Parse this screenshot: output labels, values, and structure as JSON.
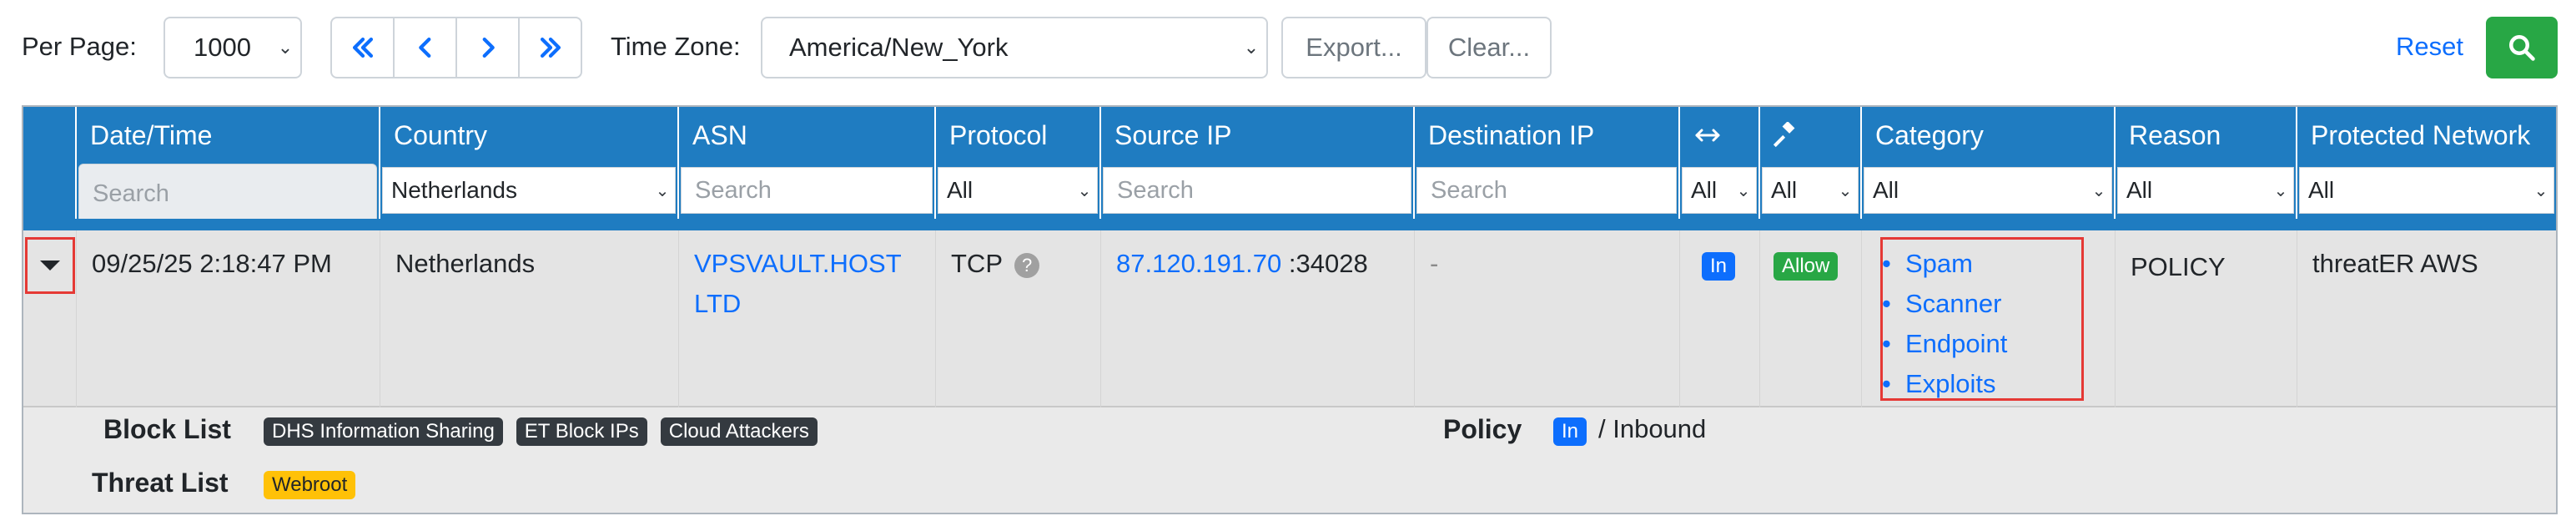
{
  "toolbar": {
    "per_page_label": "Per Page:",
    "per_page_value": "1000",
    "time_zone_label": "Time Zone:",
    "time_zone_value": "America/New_York",
    "export_label": "Export...",
    "clear_label": "Clear...",
    "reset_label": "Reset",
    "pager_icons": [
      "double-chevron-left-icon",
      "chevron-left-icon",
      "chevron-right-icon",
      "double-chevron-right-icon"
    ]
  },
  "columns": {
    "datetime": "Date/Time",
    "country": "Country",
    "asn": "ASN",
    "protocol": "Protocol",
    "source_ip": "Source IP",
    "destination_ip": "Destination IP",
    "direction_icon": "arrows-left-right-icon",
    "action_icon": "gavel-icon",
    "category": "Category",
    "reason": "Reason",
    "protected_network": "Protected Network"
  },
  "filters": {
    "datetime_placeholder": "Search",
    "country": "Netherlands",
    "asn_placeholder": "Search",
    "protocol": "All",
    "source_ip_placeholder": "Search",
    "destination_ip_placeholder": "Search",
    "direction": "All",
    "action": "All",
    "category": "All",
    "reason": "All",
    "protected_network": "All"
  },
  "row": {
    "datetime": "09/25/25 2:18:47 PM",
    "country": "Netherlands",
    "asn_line1": "VPSVAULT.HOST",
    "asn_line2": "LTD",
    "protocol": "TCP",
    "source_ip": "87.120.191.70",
    "source_port": ":34028",
    "destination_ip": "-",
    "direction_badge": "In",
    "action_badge": "Allow",
    "categories": [
      "Spam",
      "Scanner",
      "Endpoint",
      "Exploits"
    ],
    "reason": "POLICY",
    "protected_network": "threatER AWS"
  },
  "detail": {
    "block_list_label": "Block List",
    "block_list_tags": [
      "DHS Information Sharing",
      "ET Block IPs",
      "Cloud Attackers"
    ],
    "threat_list_label": "Threat List",
    "threat_list_tags": [
      "Webroot"
    ],
    "policy_label": "Policy",
    "policy_badge": "In",
    "policy_text": "/ Inbound"
  },
  "colors": {
    "header_bg": "#1f7cc1",
    "primary": "#0d6efd",
    "success": "#28a745",
    "highlight": "#e53935",
    "warning": "#ffc107"
  }
}
